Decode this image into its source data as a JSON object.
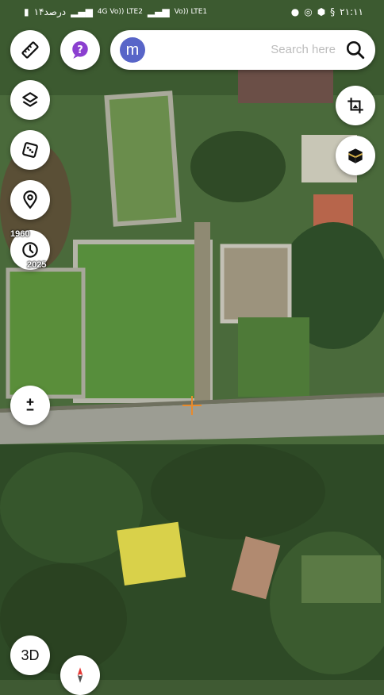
{
  "status_bar": {
    "left_text": "۱۴درصد",
    "net1_label": "4G Vo)) LTE2",
    "net2_label": "Vo)) LTE1",
    "time": "۲۱:۱۱"
  },
  "search": {
    "avatar_letter": "m",
    "placeholder": "Search here"
  },
  "time_slider": {
    "start_year": "1960",
    "end_year": "2025"
  },
  "controls": {
    "three_d_label": "3D"
  },
  "icons": [
    "ruler-icon",
    "help-chat-icon",
    "layers-icon",
    "dice-icon",
    "location-pin-icon",
    "history-clock-icon",
    "zoom-plus-minus-icon",
    "crop-image-icon",
    "kaaba-icon",
    "compass-icon",
    "search-icon"
  ]
}
